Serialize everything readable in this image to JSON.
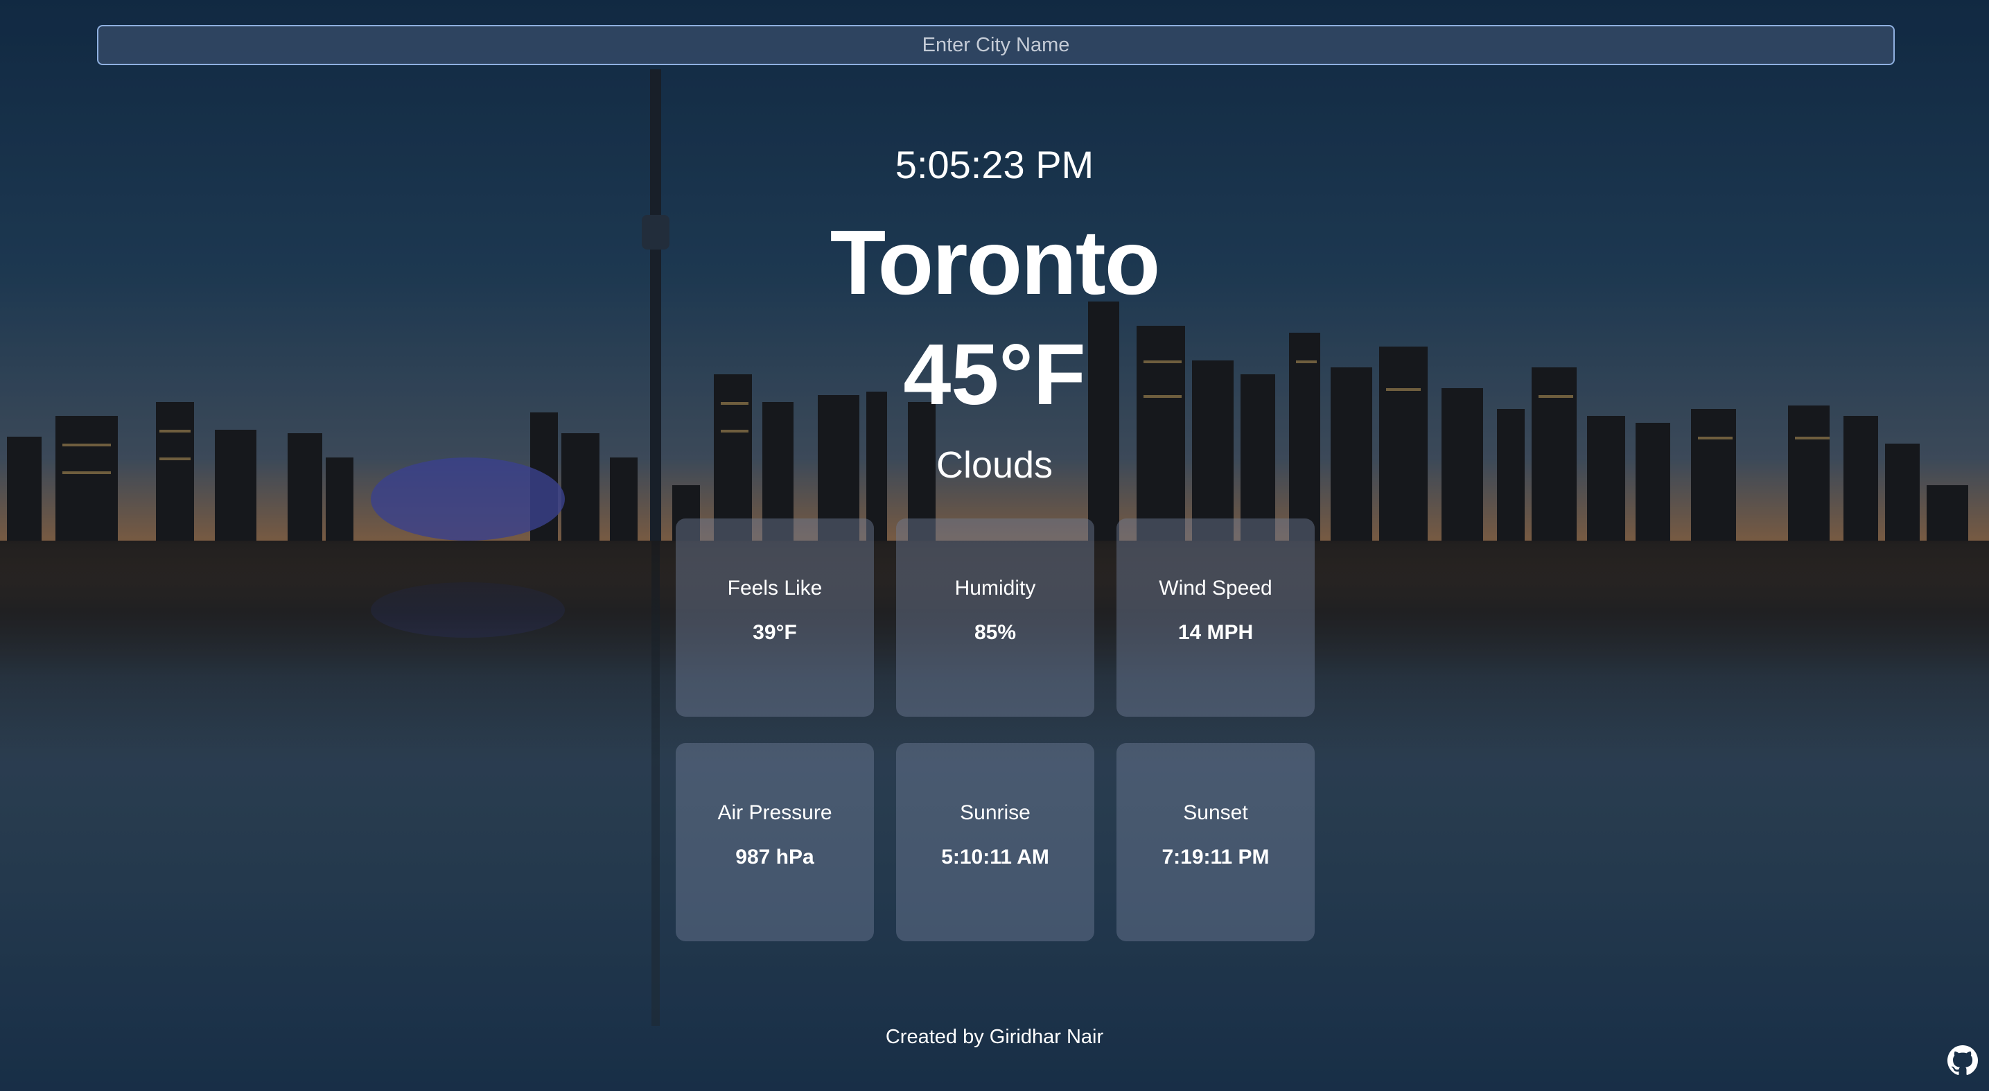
{
  "search": {
    "placeholder": "Enter City Name",
    "value": ""
  },
  "weather": {
    "time": "5:05:23 PM",
    "city": "Toronto",
    "temperature": "45°F",
    "condition": "Clouds"
  },
  "details": [
    {
      "label": "Feels Like",
      "value": "39°F"
    },
    {
      "label": "Humidity",
      "value": "85%"
    },
    {
      "label": "Wind Speed",
      "value": "14 MPH"
    },
    {
      "label": "Air Pressure",
      "value": "987 hPa"
    },
    {
      "label": "Sunrise",
      "value": "5:10:11 AM"
    },
    {
      "label": "Sunset",
      "value": "7:19:11 PM"
    }
  ],
  "footer": {
    "credit": "Created by Giridhar Nair",
    "icon": "github-icon"
  },
  "colors": {
    "card_bg": "#6e7d96",
    "input_border": "#8fb0e0",
    "text": "#ffffff"
  }
}
